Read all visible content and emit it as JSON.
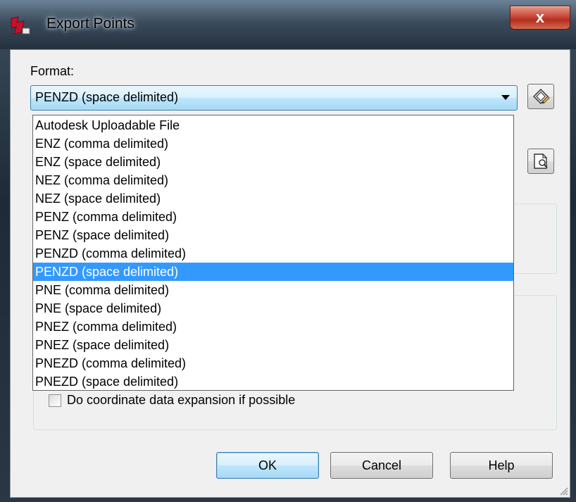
{
  "window": {
    "title": "Export Points",
    "close_label": "x"
  },
  "format": {
    "label": "Format:",
    "selected": "PENZD (space delimited)",
    "selected_index": 8,
    "options": [
      "Autodesk Uploadable File",
      "ENZ (comma delimited)",
      "ENZ (space delimited)",
      "NEZ (comma delimited)",
      "NEZ (space delimited)",
      "PENZ (comma delimited)",
      "PENZ (space delimited)",
      "PENZD (comma delimited)",
      "PENZD (space delimited)",
      "PNE (comma delimited)",
      "PNE (space delimited)",
      "PNEZ (comma delimited)",
      "PNEZ (space delimited)",
      "PNEZD (comma delimited)",
      "PNEZD (space delimited)"
    ]
  },
  "options": {
    "coordinate_expansion_label": "Do coordinate data expansion if possible",
    "coordinate_expansion_checked": false
  },
  "buttons": {
    "ok": "OK",
    "cancel": "Cancel",
    "help": "Help"
  },
  "icons": {
    "format_manager": "point-file-format-icon",
    "browse": "browse-file-icon",
    "app": "autocad-civil-icon"
  },
  "colors": {
    "selection": "#3399ff",
    "close_button": "#c9493b"
  }
}
